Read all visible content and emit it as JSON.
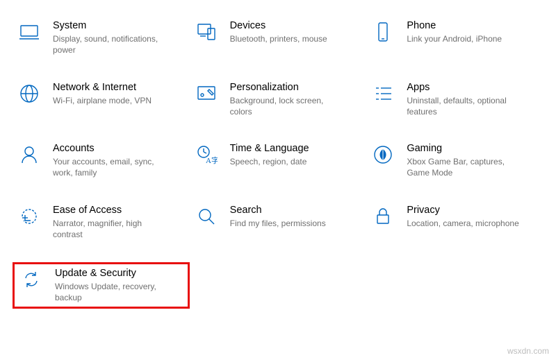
{
  "items": [
    {
      "id": "system",
      "title": "System",
      "desc": "Display, sound, notifications, power"
    },
    {
      "id": "devices",
      "title": "Devices",
      "desc": "Bluetooth, printers, mouse"
    },
    {
      "id": "phone",
      "title": "Phone",
      "desc": "Link your Android, iPhone"
    },
    {
      "id": "network",
      "title": "Network & Internet",
      "desc": "Wi-Fi, airplane mode, VPN"
    },
    {
      "id": "personalization",
      "title": "Personalization",
      "desc": "Background, lock screen, colors"
    },
    {
      "id": "apps",
      "title": "Apps",
      "desc": "Uninstall, defaults, optional features"
    },
    {
      "id": "accounts",
      "title": "Accounts",
      "desc": "Your accounts, email, sync, work, family"
    },
    {
      "id": "time",
      "title": "Time & Language",
      "desc": "Speech, region, date"
    },
    {
      "id": "gaming",
      "title": "Gaming",
      "desc": "Xbox Game Bar, captures, Game Mode"
    },
    {
      "id": "ease",
      "title": "Ease of Access",
      "desc": "Narrator, magnifier, high contrast"
    },
    {
      "id": "search",
      "title": "Search",
      "desc": "Find my files, permissions"
    },
    {
      "id": "privacy",
      "title": "Privacy",
      "desc": "Location, camera, microphone"
    },
    {
      "id": "update",
      "title": "Update & Security",
      "desc": "Windows Update, recovery, backup"
    }
  ],
  "watermark": "wsxdn.com",
  "accent_color": "#0067c0",
  "highlight_color": "#e80e0e"
}
